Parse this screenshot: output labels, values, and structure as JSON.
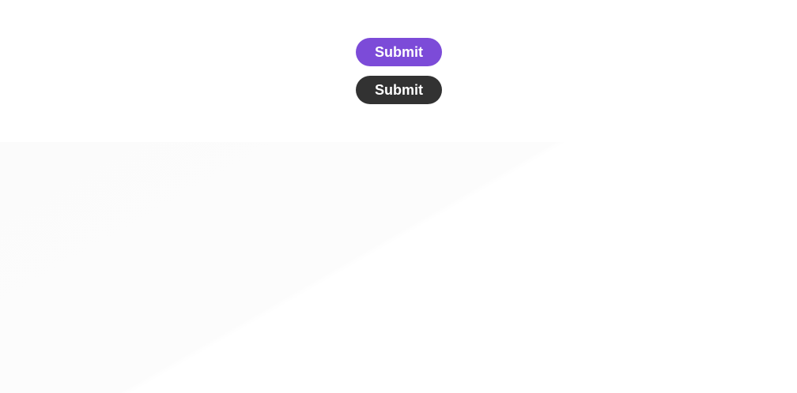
{
  "buttons": [
    {
      "label": "Submit",
      "color": "#7c4bd8",
      "text_color": "#ffffff"
    },
    {
      "label": "Submit",
      "color": "#323232",
      "text_color": "#ffffff"
    }
  ]
}
